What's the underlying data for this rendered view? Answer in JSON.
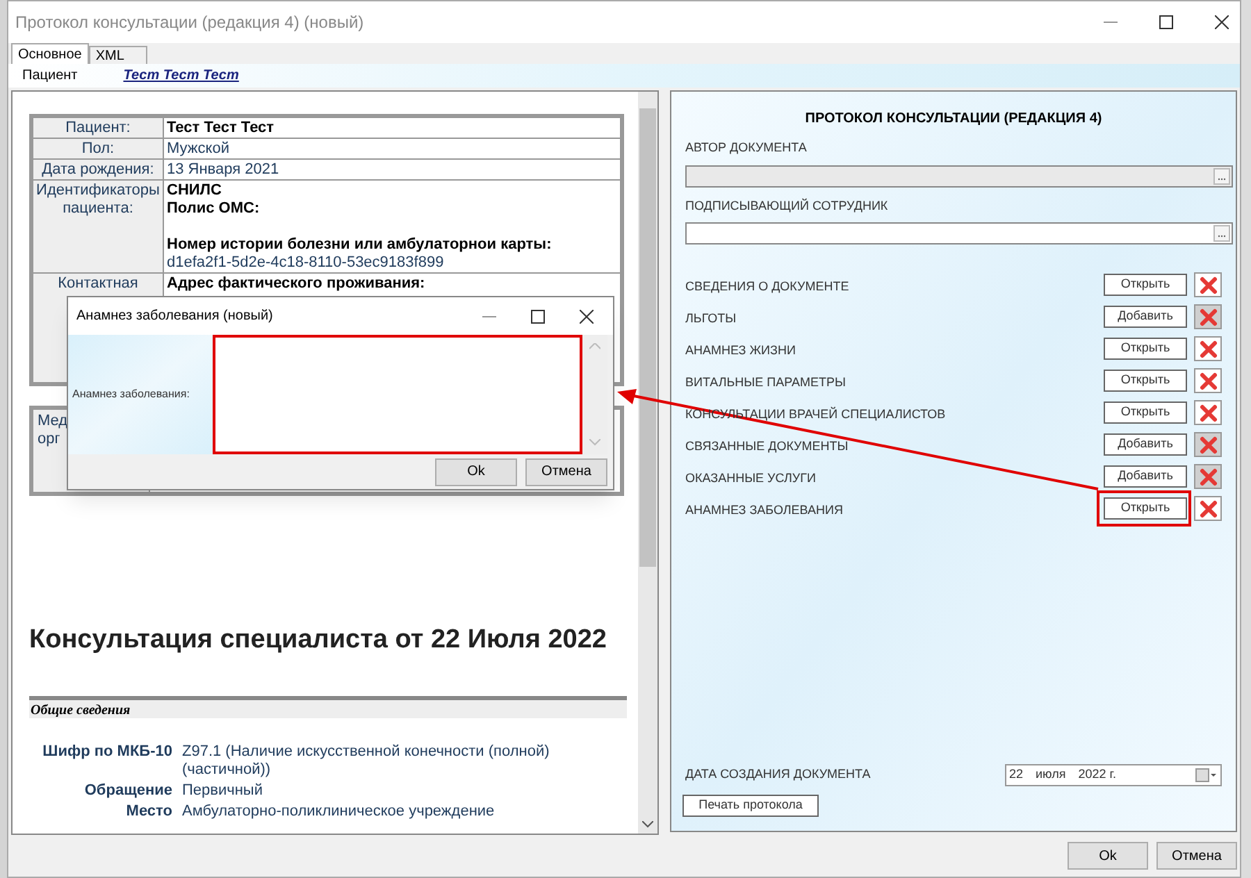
{
  "window": {
    "title": "Протокол консультации (редакция 4) (новый)",
    "buttons": [
      "Ok",
      "Отмена"
    ]
  },
  "tabs": [
    {
      "label": "Основное",
      "selected": true
    },
    {
      "label": "XML",
      "selected": false
    }
  ],
  "patient_bar": {
    "label": "Пациент",
    "name": "Тест Тест Тест"
  },
  "document": {
    "patient_table": [
      {
        "label": "Пациент:",
        "groups": [
          [
            {
              "kind": "heading",
              "text": "Тест Тест Тест"
            }
          ]
        ]
      },
      {
        "label": "Пол:",
        "groups": [
          [
            {
              "kind": "text",
              "text": "Мужской"
            }
          ]
        ]
      },
      {
        "label": "Дата рождения:",
        "groups": [
          [
            {
              "kind": "text",
              "text": "13 Января 2021"
            }
          ]
        ]
      },
      {
        "label": "Идентификаторы пациента:",
        "groups": [
          [
            {
              "kind": "heading",
              "text": "СНИЛС"
            },
            {
              "kind": "heading",
              "text": "Полис ОМС:"
            }
          ],
          [
            {
              "kind": "heading",
              "text": "Номер истории болезни или амбулаторнои карты:"
            },
            {
              "kind": "text",
              "text": "d1efa2f1-5d2e-4c18-8110-53ec9183f899"
            }
          ]
        ]
      },
      {
        "label": "Контактная",
        "groups": [
          [
            {
              "kind": "heading",
              "text": "Адрес фактического проживания:"
            }
          ]
        ]
      }
    ],
    "org_label_lines": [
      "Мед",
      "орг"
    ],
    "heading": "Консультация специалиста от 22 Июля 2022",
    "section": "Общие сведения",
    "rows": [
      {
        "label": "Шифр по МКБ-10",
        "value": "Z97.1 (Наличие искусственной конечности (полной) (частичной))"
      },
      {
        "label": "Обращение",
        "value": "Первичный"
      },
      {
        "label": "Место",
        "value": "Амбулаторно-поликлиническое учреждение"
      }
    ]
  },
  "form": {
    "title": "ПРОТОКОЛ КОНСУЛЬТАЦИИ (РЕДАКЦИЯ 4)",
    "fields": [
      {
        "label": "АВТОР ДОКУМЕНТА",
        "disabled": true
      },
      {
        "label": "ПОДПИСЫВАЮЩИЙ СОТРУДНИК",
        "disabled": false
      }
    ],
    "sections": [
      {
        "label": "СВЕДЕНИЯ О ДОКУМЕНТЕ",
        "action": "Открыть",
        "delete_disabled": false,
        "highlighted": false
      },
      {
        "label": "ЛЬГОТЫ",
        "action": "Добавить",
        "delete_disabled": true,
        "highlighted": false
      },
      {
        "label": "АНАМНЕЗ ЖИЗНИ",
        "action": "Открыть",
        "delete_disabled": false,
        "highlighted": false
      },
      {
        "label": "ВИТАЛЬНЫЕ ПАРАМЕТРЫ",
        "action": "Открыть",
        "delete_disabled": false,
        "highlighted": false
      },
      {
        "label": "КОНСУЛЬТАЦИИ ВРАЧЕЙ СПЕЦИАЛИСТОВ",
        "action": "Открыть",
        "delete_disabled": false,
        "highlighted": false
      },
      {
        "label": "СВЯЗАННЫЕ ДОКУМЕНТЫ",
        "action": "Добавить",
        "delete_disabled": true,
        "highlighted": false
      },
      {
        "label": "ОКАЗАННЫЕ УСЛУГИ",
        "action": "Добавить",
        "delete_disabled": true,
        "highlighted": false
      },
      {
        "label": "АНАМНЕЗ ЗАБОЛЕВАНИЯ",
        "action": "Открыть",
        "delete_disabled": false,
        "highlighted": true
      }
    ],
    "date": {
      "label": "ДАТА СОЗДАНИЯ ДОКУМЕНТА",
      "day": "22",
      "month": "июля",
      "year": "2022 г."
    },
    "print_button": "Печать протокола"
  },
  "dialog": {
    "title": "Анамнез заболевания (новый)",
    "field_label": "Анамнез заболевания:",
    "buttons": [
      "Ok",
      "Отмена"
    ]
  }
}
